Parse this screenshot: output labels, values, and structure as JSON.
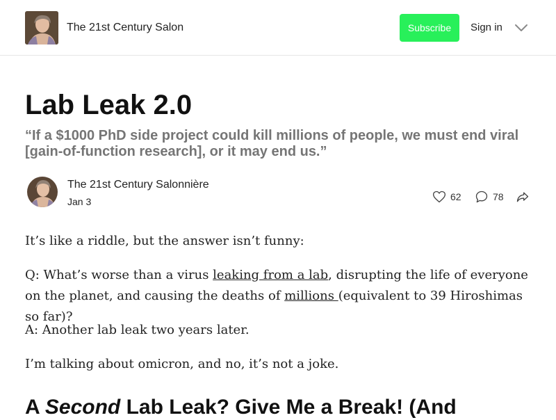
{
  "header": {
    "publication_name": "The 21st Century Salon",
    "subscribe_label": "Subscribe",
    "signin_label": "Sign in",
    "accent_color": "#28f05a"
  },
  "post": {
    "title": "Lab Leak 2.0",
    "subtitle": "“If a $1000 PhD side project could kill millions of people, we must end viral [gain-of-function research], or it may end us.”",
    "author": "The 21st Century Salonnière",
    "date": "Jan 3",
    "likes": "62",
    "comments": "78"
  },
  "body": {
    "p1": "It’s like a riddle, but the answer isn’t funny:",
    "p2_before": "Q: What’s worse than a virus ",
    "p2_link1": "leaking from a lab",
    "p2_middle": ", disrupting the life of everyone on the planet, and causing the deaths of ",
    "p2_link2": "millions ",
    "p2_after": " (equivalent to 39 Hiroshimas so far)?",
    "p3": "A: Another lab leak two years later.",
    "p4": "I’m talking about omicron, and no, it’s not a joke.",
    "heading_before": "A ",
    "heading_emphasis": "Second",
    "heading_after": " Lab Leak? Give Me a Break! (And"
  },
  "icons": {
    "logo": "portrait-painting-icon",
    "menu": "chevron-down-icon",
    "likes": "heart-icon",
    "comments": "comment-bubble-icon",
    "share": "share-arrow-icon"
  }
}
